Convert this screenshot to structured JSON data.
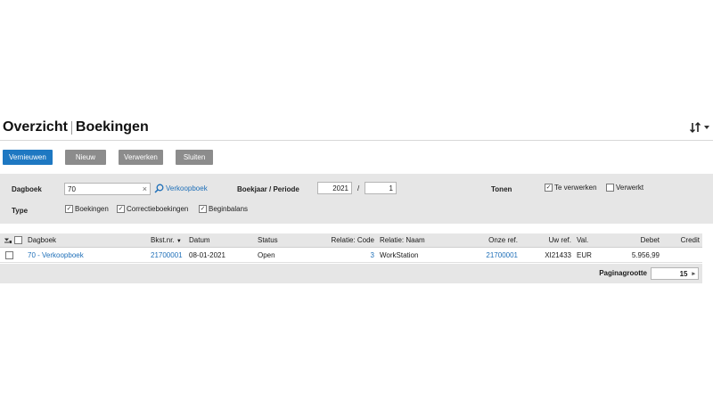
{
  "header": {
    "title_part1": "Overzicht",
    "title_part2": "Boekingen",
    "menu_icon": "sort-menu-icon"
  },
  "toolbar": {
    "refresh_label": "Vernieuwen",
    "new_label": "Nieuw",
    "process_label": "Verwerken",
    "close_label": "Sluiten",
    "accent_color": "#1e78c2"
  },
  "filters": {
    "journal_label": "Dagboek",
    "journal_value": "70",
    "journal_clear": "×",
    "journal_lookup_icon": "search-icon",
    "journal_lookup_text": "Verkoopboek",
    "year_period_label": "Boekjaar / Periode",
    "year_value": "2021",
    "period_separator": "/",
    "period_value": "1",
    "show_label": "Tonen",
    "to_process_label": "Te verwerken",
    "to_process_checked": true,
    "processed_label": "Verwerkt",
    "processed_checked": false,
    "type_label": "Type",
    "types": [
      {
        "label": "Boekingen",
        "checked": true
      },
      {
        "label": "Correctieboekingen",
        "checked": true
      },
      {
        "label": "Beginbalans",
        "checked": true
      }
    ]
  },
  "table": {
    "columns": {
      "journal": "Dagboek",
      "entry_no": "Bkst.nr.",
      "date": "Datum",
      "status": "Status",
      "relation_code": "Relatie: Code",
      "relation_name": "Relatie: Naam",
      "our_ref": "Onze ref.",
      "your_ref": "Uw ref.",
      "currency": "Val.",
      "debit": "Debet",
      "credit": "Credit"
    },
    "sort_indicator": "▼",
    "rows": [
      {
        "journal": "70 - Verkoopboek",
        "entry_no": "21700001",
        "date": "08-01-2021",
        "status": "Open",
        "relation_code": "3",
        "relation_name": "WorkStation",
        "our_ref": "21700001",
        "your_ref": "XI21433",
        "currency": "EUR",
        "debit": "5.956,99",
        "credit": ""
      }
    ]
  },
  "pager": {
    "page_size_label": "Paginagrootte",
    "page_size_value": "15",
    "page_size_arrow": "▸"
  }
}
